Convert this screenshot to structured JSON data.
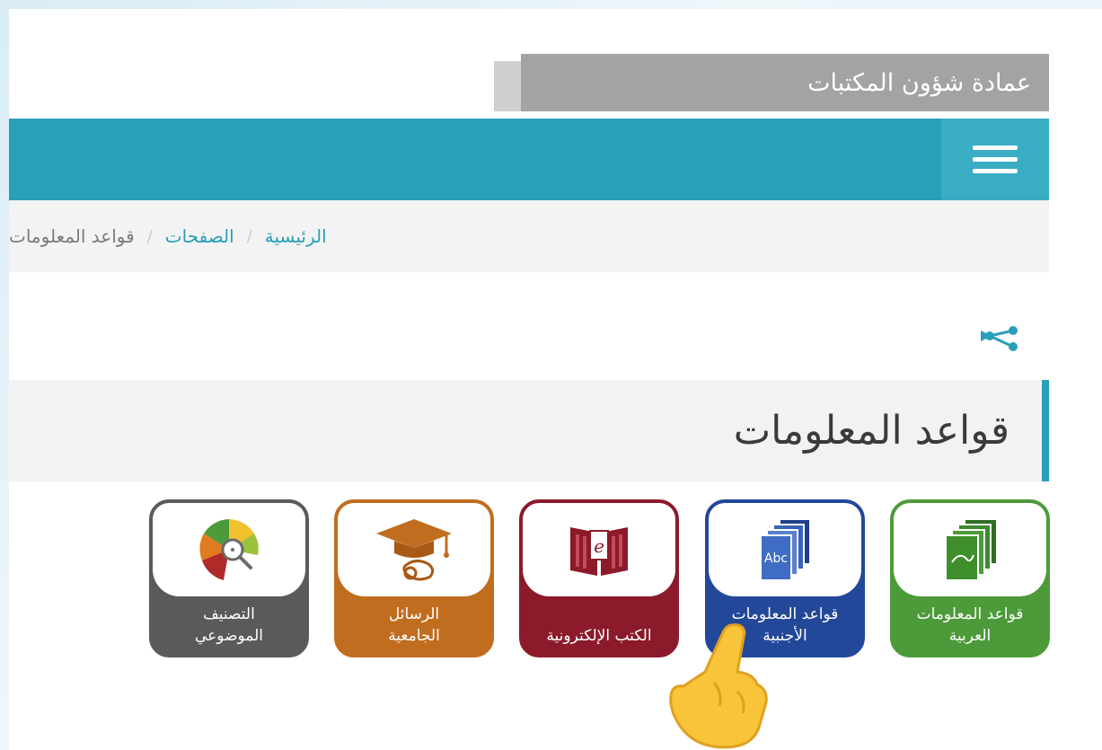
{
  "header": {
    "site_title": "عمادة شؤون المكتبات"
  },
  "nav": {
    "menu_icon": "hamburger-menu-icon"
  },
  "breadcrumb": {
    "items": [
      {
        "label": "الرئيسية"
      },
      {
        "label": "الصفحات"
      }
    ],
    "separator": "/",
    "current": "قواعد المعلومات"
  },
  "share": {
    "icon": "share-icon"
  },
  "page": {
    "heading": "قواعد المعلومات"
  },
  "tiles": [
    {
      "label": "قواعد المعلومات\nالعربية",
      "icon": "arabic-documents-icon",
      "color": "#4d9a3a"
    },
    {
      "label": "قواعد المعلومات\nالأجنبية",
      "icon": "abc-documents-icon",
      "color": "#23489a"
    },
    {
      "label": "الكتب الإلكترونية",
      "icon": "ebook-icon",
      "color": "#8b1a2a"
    },
    {
      "label": "الرسائل\nالجامعية",
      "icon": "graduation-cap-icon",
      "color": "#c06d1f"
    },
    {
      "label": "التصنيف\nالموضوعي",
      "icon": "classification-chart-icon",
      "color": "#5a5a5a"
    }
  ],
  "colors": {
    "accent": "#2a9fb8",
    "title_bar": "#a3a3a3"
  }
}
